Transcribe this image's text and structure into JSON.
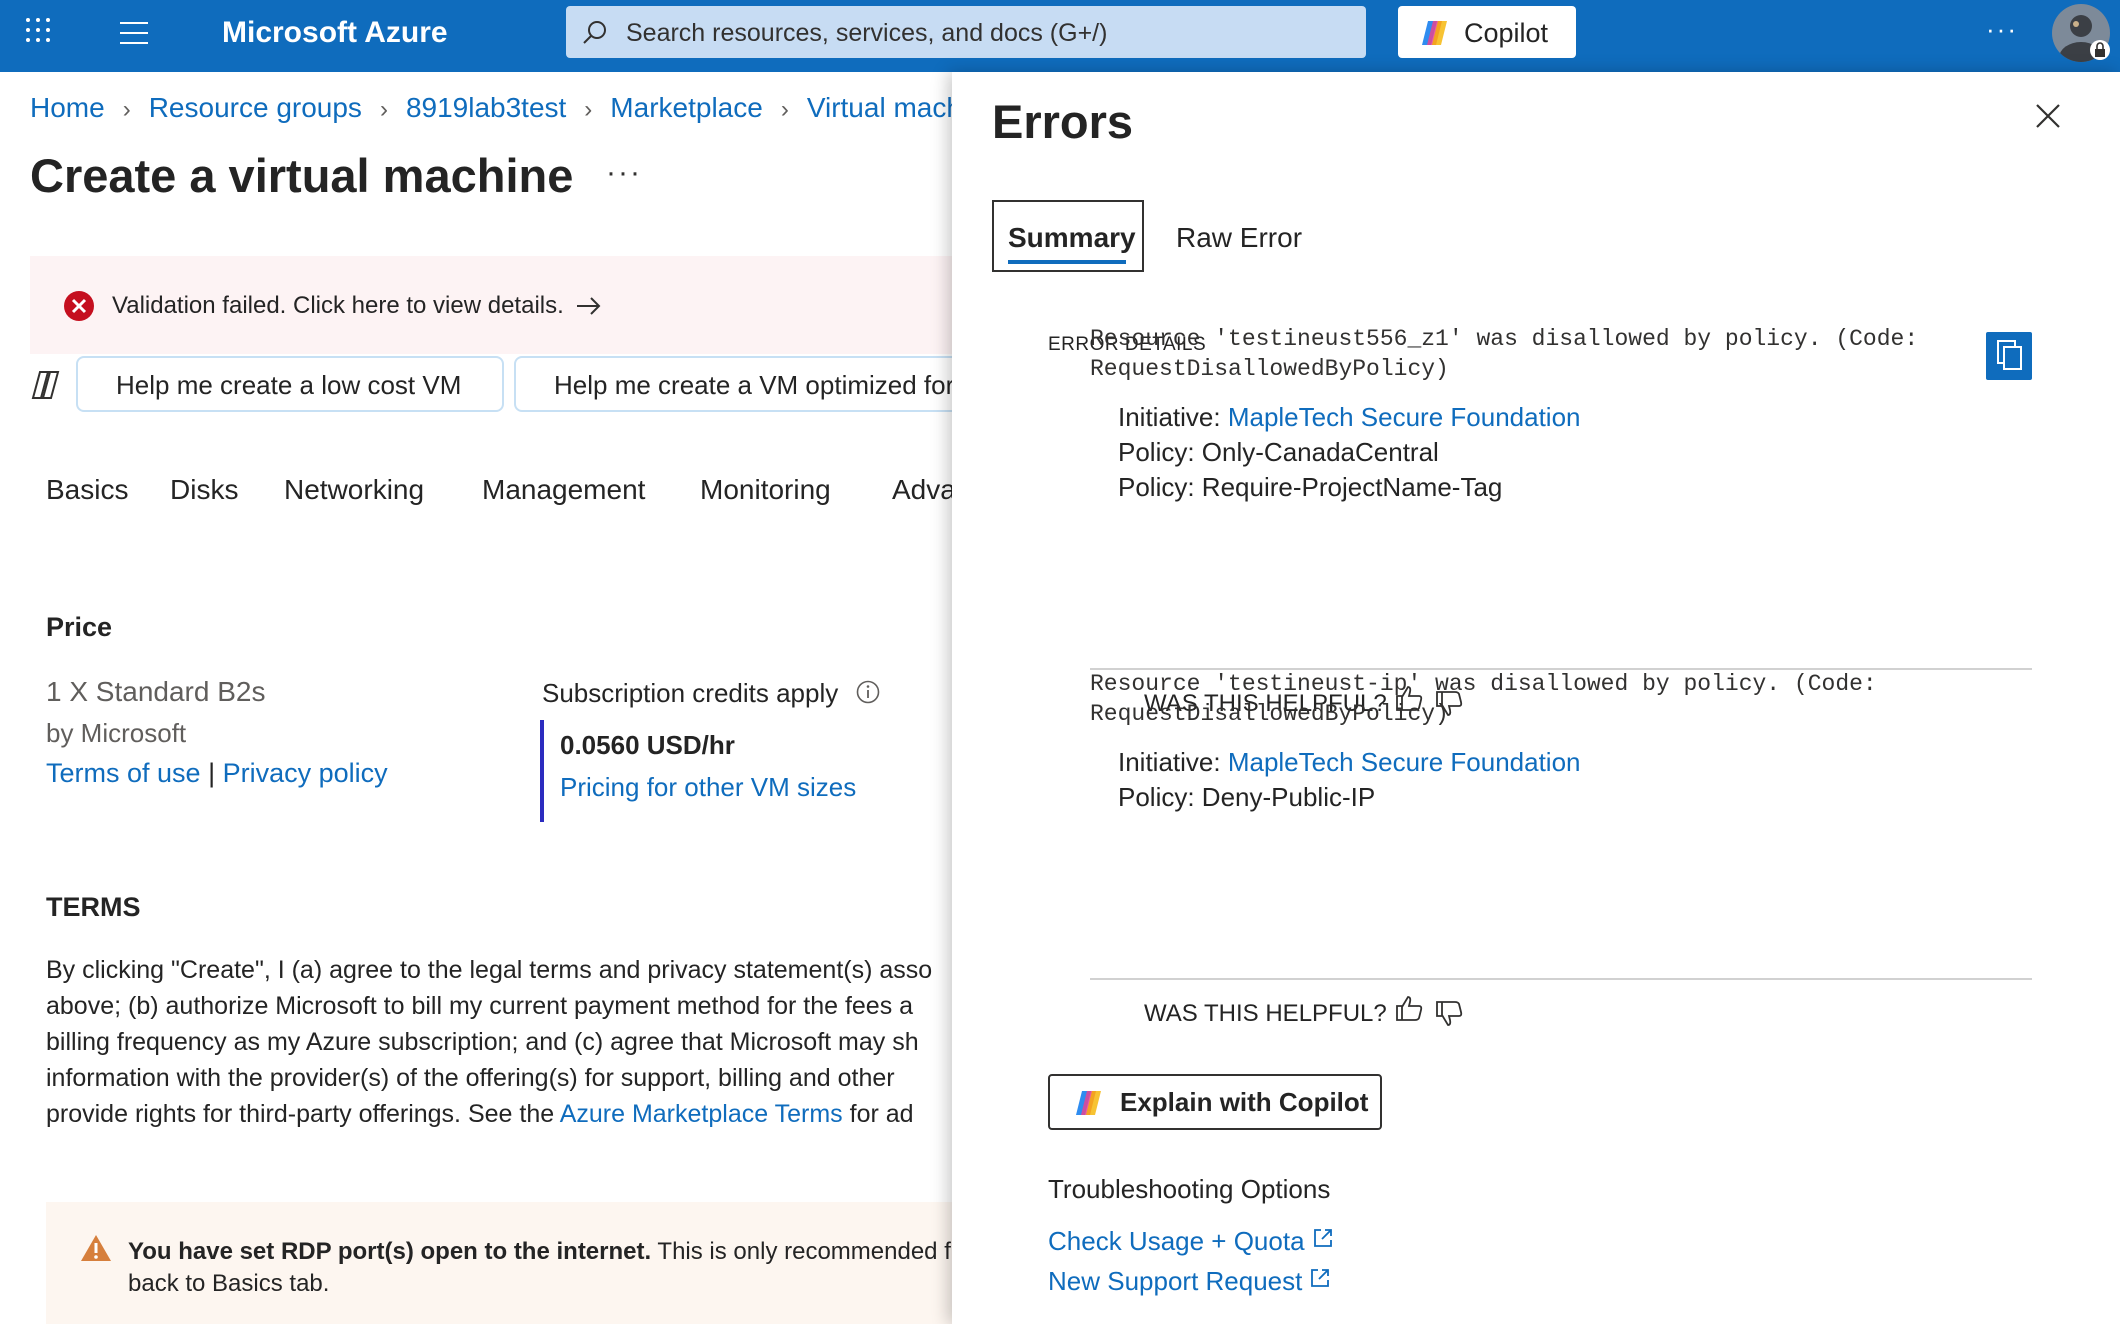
{
  "topbar": {
    "brand": "Microsoft Azure",
    "search_placeholder": "Search resources, services, and docs (G+/)",
    "copilot_label": "Copilot",
    "more": "···",
    "accent": "#0f6cbd"
  },
  "breadcrumb": [
    "Home",
    "Resource groups",
    "8919lab3test",
    "Marketplace",
    "Virtual mach"
  ],
  "page": {
    "title": "Create a virtual machine",
    "more": "···"
  },
  "validation": {
    "text": "Validation failed. Click here to view details."
  },
  "suggestions": [
    "Help me create a low cost VM",
    "Help me create a VM optimized for"
  ],
  "tabs": [
    "Basics",
    "Disks",
    "Networking",
    "Management",
    "Monitoring",
    "Adva"
  ],
  "price": {
    "heading": "Price",
    "sku": "1 X Standard B2s",
    "publisher": "by Microsoft",
    "terms_link": "Terms of use",
    "separator": "|",
    "privacy_link": "Privacy policy",
    "credits": "Subscription credits apply",
    "amount": "0.0560 USD/hr",
    "other_sizes": "Pricing for other VM sizes"
  },
  "terms": {
    "heading": "TERMS",
    "line1": "By clicking \"Create\", I (a) agree to the legal terms and privacy statement(s) asso",
    "line2": "above; (b) authorize Microsoft to bill my current payment method for the fees a",
    "line3": "billing frequency as my Azure subscription; and (c) agree that Microsoft may sh",
    "line4": "information with the provider(s) of the offering(s) for support, billing and other",
    "line5_pre": "provide rights for third-party offerings. See the ",
    "line5_link": "Azure Marketplace Terms",
    "line5_post": " for ad"
  },
  "warning": {
    "bold": "You have set RDP port(s) open to the internet.",
    "rest": " This is only recommended f",
    "line2": "back to Basics tab."
  },
  "errors_panel": {
    "title": "Errors",
    "tab_summary": "Summary",
    "tab_raw": "Raw Error",
    "details_label": "ERROR DETAILS",
    "errors": [
      {
        "line1": "Resource 'testineust556_z1' was disallowed by policy. (Code:",
        "line2": "RequestDisallowedByPolicy)",
        "initiative_label": "Initiative: ",
        "initiative": "MapleTech Secure Foundation",
        "policies": [
          "Policy: Only-CanadaCentral",
          "Policy: Require-ProjectName-Tag"
        ],
        "helpful": "WAS THIS HELPFUL?"
      },
      {
        "line1": "Resource 'testineust-ip' was disallowed by policy. (Code:",
        "line2": "RequestDisallowedByPolicy)",
        "initiative_label": "Initiative: ",
        "initiative": "MapleTech Secure Foundation",
        "policies": [
          "Policy: Deny-Public-IP"
        ],
        "helpful": "WAS THIS HELPFUL?"
      }
    ],
    "explain_button": "Explain with Copilot",
    "troubleshooting_heading": "Troubleshooting Options",
    "links": [
      "Check Usage + Quota",
      "New Support Request"
    ]
  }
}
